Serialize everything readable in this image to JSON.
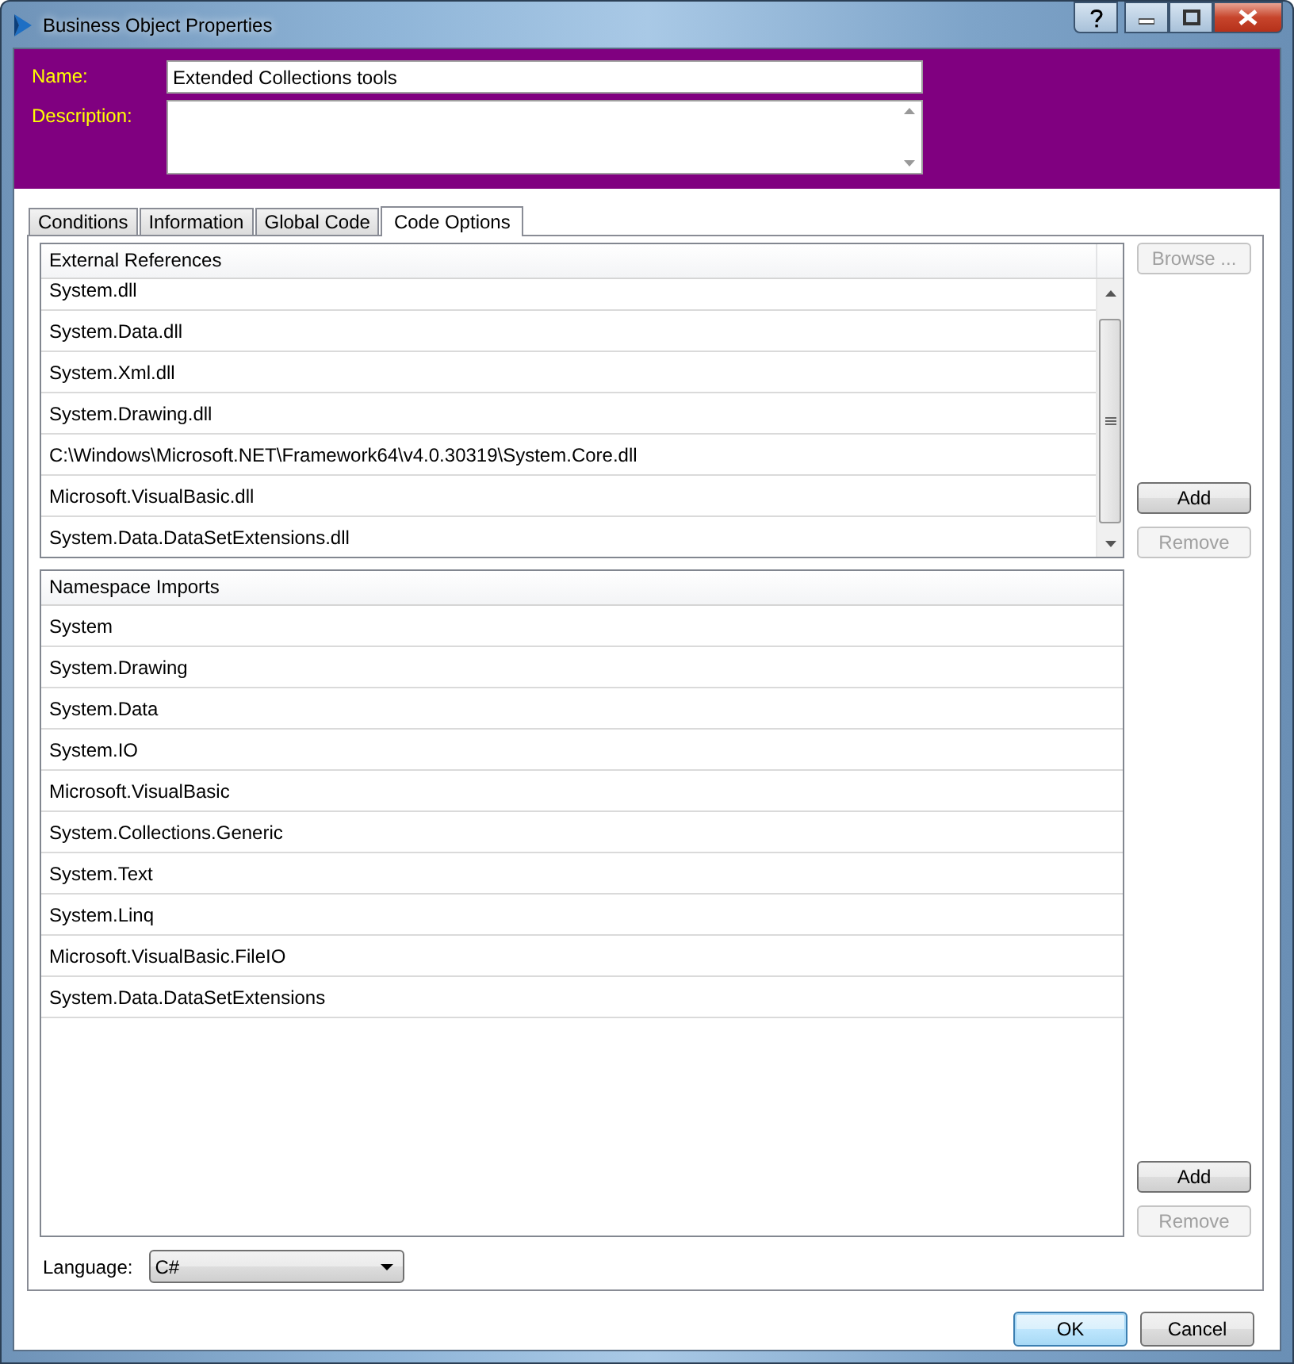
{
  "window": {
    "title": "Business Object Properties"
  },
  "header": {
    "name_label": "Name:",
    "name_value": "Extended Collections tools",
    "description_label": "Description:"
  },
  "tabs": [
    {
      "label": "Conditions",
      "selected": false
    },
    {
      "label": "Information",
      "selected": false
    },
    {
      "label": "Global Code",
      "selected": false
    },
    {
      "label": "Code Options",
      "selected": true
    }
  ],
  "external_references": {
    "header": "External References",
    "rows": [
      "System.dll",
      "System.Data.dll",
      "System.Xml.dll",
      "System.Drawing.dll",
      "C:\\Windows\\Microsoft.NET\\Framework64\\v4.0.30319\\System.Core.dll",
      "Microsoft.VisualBasic.dll",
      "System.Data.DataSetExtensions.dll"
    ],
    "top_button": {
      "label": "Browse ...",
      "disabled": true
    },
    "buttons": [
      {
        "label": "Add",
        "disabled": false
      },
      {
        "label": "Remove",
        "disabled": true
      }
    ]
  },
  "namespace_imports": {
    "header": "Namespace Imports",
    "rows": [
      "System",
      "System.Drawing",
      "System.Data",
      "System.IO",
      "Microsoft.VisualBasic",
      "System.Collections.Generic",
      "System.Text",
      "System.Linq",
      "Microsoft.VisualBasic.FileIO",
      "System.Data.DataSetExtensions"
    ],
    "buttons": [
      {
        "label": "Add",
        "disabled": false
      },
      {
        "label": "Remove",
        "disabled": true
      }
    ]
  },
  "language": {
    "label": "Language:",
    "value": "C#"
  },
  "dialog_buttons": [
    {
      "label": "OK",
      "default": true
    },
    {
      "label": "Cancel",
      "default": false
    }
  ]
}
